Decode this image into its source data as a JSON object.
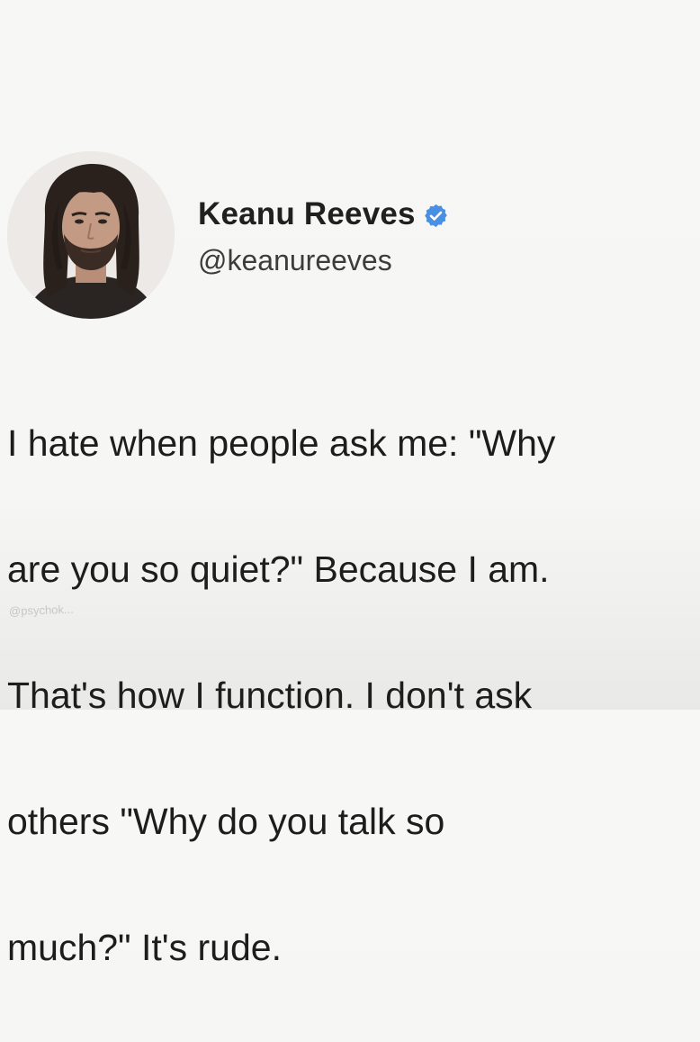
{
  "tweet": {
    "display_name": "Keanu Reeves",
    "handle": "@keanureeves",
    "verified": true,
    "verified_icon": "verified-badge-icon",
    "verified_color": "#4a90e2",
    "text_lines": [
      "I hate when people ask me: \"Why",
      "are you so quiet?\" Because I am.",
      "That's how I function. I don't ask",
      "others \"Why do you talk so",
      "much?\" It's rude."
    ],
    "watermark": "@psychok..."
  }
}
